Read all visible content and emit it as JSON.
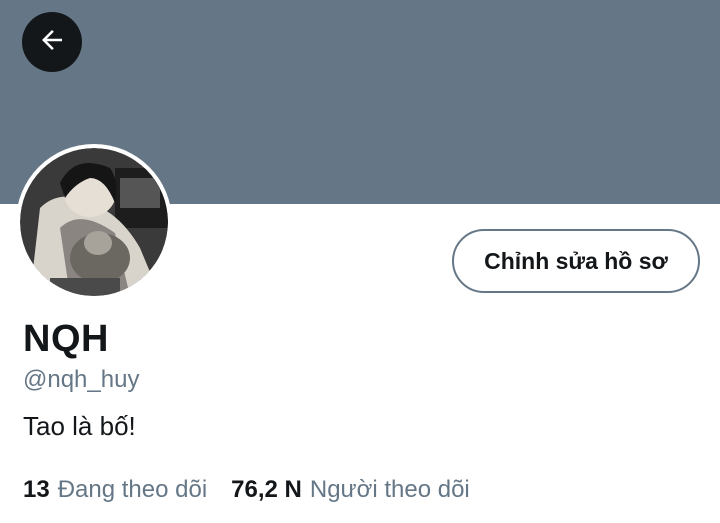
{
  "profile": {
    "display_name": "NQH",
    "handle": "@nqh_huy",
    "bio": "Tao là bố!"
  },
  "actions": {
    "edit_profile_label": "Chỉnh sửa hồ sơ",
    "back_icon": "arrow-left-icon"
  },
  "stats": {
    "following_count": "13",
    "following_label": "Đang theo dõi",
    "followers_count": "76,2 N",
    "followers_label": "Người theo dõi"
  },
  "colors": {
    "banner": "#657786",
    "text_primary": "#14171a",
    "text_secondary": "#657786"
  }
}
